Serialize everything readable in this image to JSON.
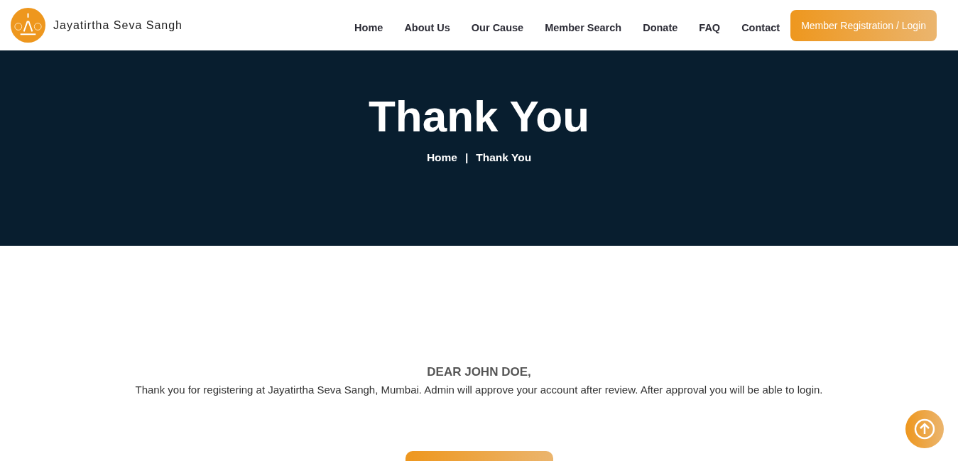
{
  "header": {
    "brand": "Jayatirtha Seva Sangh",
    "nav": [
      "Home",
      "About Us",
      "Our Cause",
      "Member Search",
      "Donate",
      "FAQ",
      "Contact"
    ],
    "cta": "Member Registration / Login"
  },
  "hero": {
    "title": "Thank You",
    "breadcrumb": [
      "Home",
      "Thank You"
    ],
    "separator": "|"
  },
  "message": {
    "greeting": "DEAR JOHN DOE,",
    "body": "Thank you for registering at Jayatirtha Seva Sangh, Mumbai. Admin will approve your account after review. After approval you will be able to login."
  }
}
